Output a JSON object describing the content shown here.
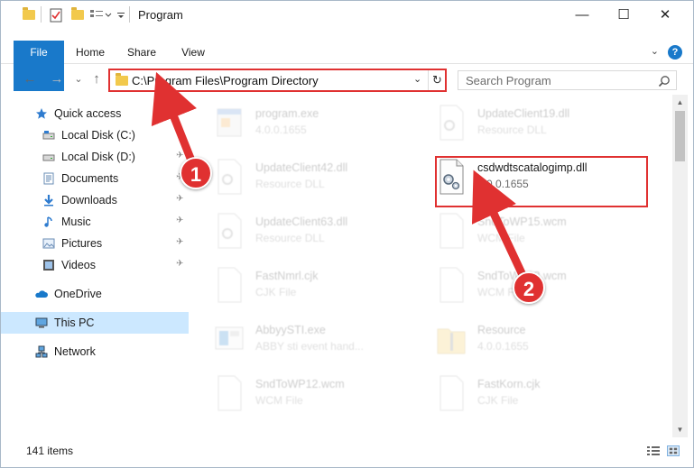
{
  "window": {
    "title": "Program",
    "minimize_glyph": "—",
    "maximize_glyph": "☐",
    "close_glyph": "✕"
  },
  "ribbon": {
    "tabs": [
      "File",
      "Home",
      "Share",
      "View"
    ],
    "help_label": "?",
    "expand_glyph": "⌄"
  },
  "address_bar": {
    "path": "C:\\Program Files\\Program Directory",
    "dropdown_glyph": "⌄",
    "refresh_glyph": "↻"
  },
  "search": {
    "placeholder": "Search Program"
  },
  "nav_buttons": {
    "back": "←",
    "forward": "→",
    "recent": "⌄",
    "up": "↑"
  },
  "nav_pane": {
    "items": [
      {
        "label": "Quick access",
        "icon": "star-icon",
        "pinned": false
      },
      {
        "label": "Local Disk (C:)",
        "icon": "drive-icon",
        "pinned": true
      },
      {
        "label": "Local Disk (D:)",
        "icon": "drive-icon",
        "pinned": true
      },
      {
        "label": "Documents",
        "icon": "documents-icon",
        "pinned": true
      },
      {
        "label": "Downloads",
        "icon": "downloads-icon",
        "pinned": true
      },
      {
        "label": "Music",
        "icon": "music-icon",
        "pinned": true
      },
      {
        "label": "Pictures",
        "icon": "pictures-icon",
        "pinned": true
      },
      {
        "label": "Videos",
        "icon": "videos-icon",
        "pinned": true
      },
      {
        "label": "OneDrive",
        "icon": "cloud-icon",
        "pinned": false
      },
      {
        "label": "This PC",
        "icon": "computer-icon",
        "pinned": false,
        "selected": true
      },
      {
        "label": "Network",
        "icon": "network-icon",
        "pinned": false
      }
    ],
    "pin_glyph": "📌"
  },
  "files": [
    {
      "name": "program.exe",
      "desc": "4.0.0.1655",
      "icon": "exe-icon",
      "faded": true
    },
    {
      "name": "UpdateClient19.dll",
      "desc": "Resource DLL",
      "icon": "dll-icon",
      "faded": true
    },
    {
      "name": "UpdateClient42.dll",
      "desc": "Resource DLL",
      "icon": "dll-icon",
      "faded": true
    },
    {
      "name": "csdwdtscatalogimp.dll",
      "desc": "4.0.0.1655",
      "icon": "dll-gear-icon",
      "faded": false,
      "highlighted": true
    },
    {
      "name": "UpdateClient63.dll",
      "desc": "Resource DLL",
      "icon": "dll-icon",
      "faded": true
    },
    {
      "name": "SndToWP15.wcm",
      "desc": "WCM File",
      "icon": "blank-file-icon",
      "faded": true
    },
    {
      "name": "FastNmrl.cjk",
      "desc": "CJK File",
      "icon": "blank-file-icon",
      "faded": true
    },
    {
      "name": "SndToWP18.wcm",
      "desc": "WCM File",
      "icon": "blank-file-icon",
      "faded": true
    },
    {
      "name": "AbbyySTI.exe",
      "desc": "ABBY sti event hand...",
      "icon": "app-icon",
      "faded": true
    },
    {
      "name": "Resource",
      "desc": "4.0.0.1655",
      "icon": "zip-folder-icon",
      "faded": true
    },
    {
      "name": "SndToWP12.wcm",
      "desc": "WCM File",
      "icon": "blank-file-icon",
      "faded": true
    },
    {
      "name": "FastKorn.cjk",
      "desc": "CJK File",
      "icon": "blank-file-icon",
      "faded": true
    }
  ],
  "status_bar": {
    "item_count": "141 items"
  },
  "annotations": {
    "step1": "1",
    "step2": "2"
  },
  "colors": {
    "accent": "#1979ca",
    "highlight_red": "#e03131",
    "selection": "#cce8ff"
  }
}
